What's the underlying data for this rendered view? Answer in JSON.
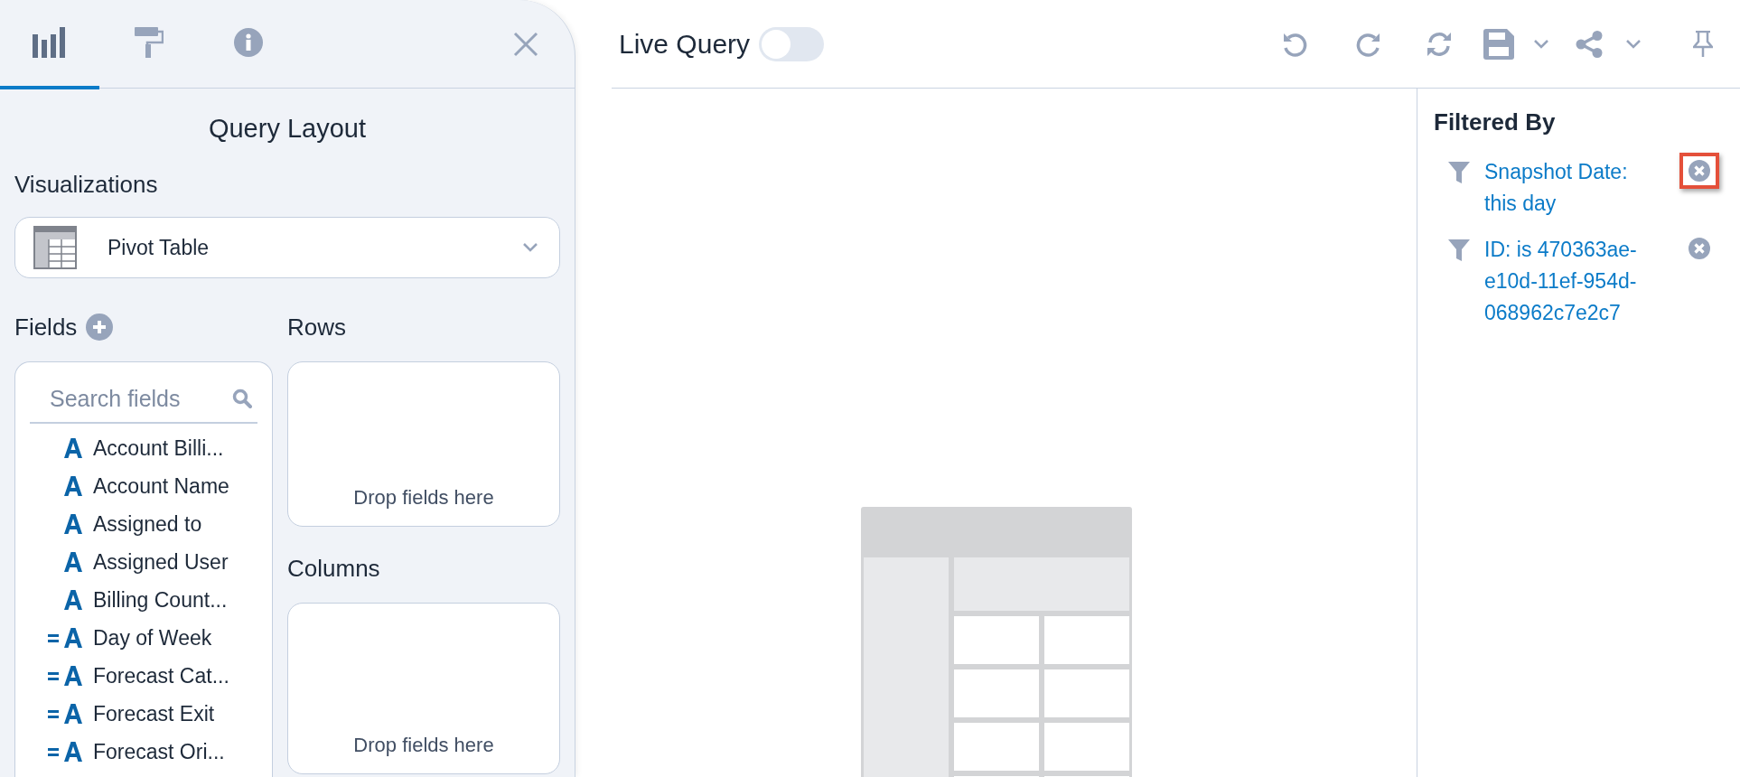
{
  "side_panel": {
    "tabs": [
      {
        "kind": "chart",
        "selected": true
      },
      {
        "kind": "format",
        "selected": false
      },
      {
        "kind": "info",
        "selected": false
      }
    ],
    "title": "Query Layout",
    "visualizations": {
      "label": "Visualizations",
      "value": "Pivot Table"
    },
    "fields": {
      "label": "Fields",
      "search": {
        "placeholder": "Search fields"
      },
      "items": [
        {
          "kind": "text",
          "label": "Account Billi..."
        },
        {
          "kind": "text",
          "label": "Account Name"
        },
        {
          "kind": "text",
          "label": "Assigned to"
        },
        {
          "kind": "text",
          "label": "Assigned User"
        },
        {
          "kind": "text",
          "label": "Billing Count..."
        },
        {
          "kind": "enum",
          "label": "Day of Week"
        },
        {
          "kind": "enum",
          "label": "Forecast Cat..."
        },
        {
          "kind": "enum",
          "label": "Forecast Exit"
        },
        {
          "kind": "enum",
          "label": "Forecast Ori..."
        }
      ]
    },
    "rows": {
      "label": "Rows",
      "hint": "Drop fields here"
    },
    "columns": {
      "label": "Columns",
      "hint": "Drop fields here"
    }
  },
  "toolbar": {
    "live_query": {
      "label": "Live Query",
      "on": false
    }
  },
  "filters": {
    "title": "Filtered By",
    "items": [
      {
        "text": "Snapshot Date: this day",
        "highlighted": true
      },
      {
        "text": "ID: is 470363ae-e10d-11ef-954d-068962c7e2c7",
        "highlighted": false
      }
    ]
  }
}
